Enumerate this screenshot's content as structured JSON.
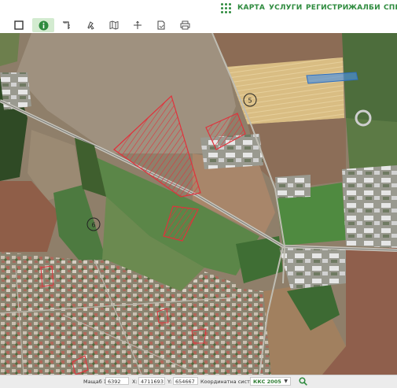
{
  "nav": {
    "items": [
      "КАРТА",
      "УСЛУГИ",
      "РЕГИСТРИ",
      "ЖАЛБИ",
      "СПРА"
    ]
  },
  "toolbar": {
    "tools": [
      "select-rectangle-icon",
      "info-icon",
      "measure-angle-icon",
      "pan-icon",
      "map-layers-icon",
      "position-cross-icon",
      "document-icon",
      "print-icon"
    ],
    "active_tool": "info-icon"
  },
  "map": {
    "labels": {
      "marker_a": "5",
      "marker_b": "6"
    },
    "colors": {
      "parcel_outline": "#e0323c",
      "highlight": "#4a90e2",
      "grain_field": "#d9bd83",
      "green_field": "#5f8e4d",
      "brown_field": "#8f6a56"
    }
  },
  "statusbar": {
    "scale_label": "Мащаб 1:",
    "scale_value": "6392",
    "x_label": "X:",
    "x_value": "4711693",
    "y_label": "Y:",
    "y_value": "654667",
    "crs_label": "Координатна система:",
    "crs_value": "ККС 2005"
  }
}
